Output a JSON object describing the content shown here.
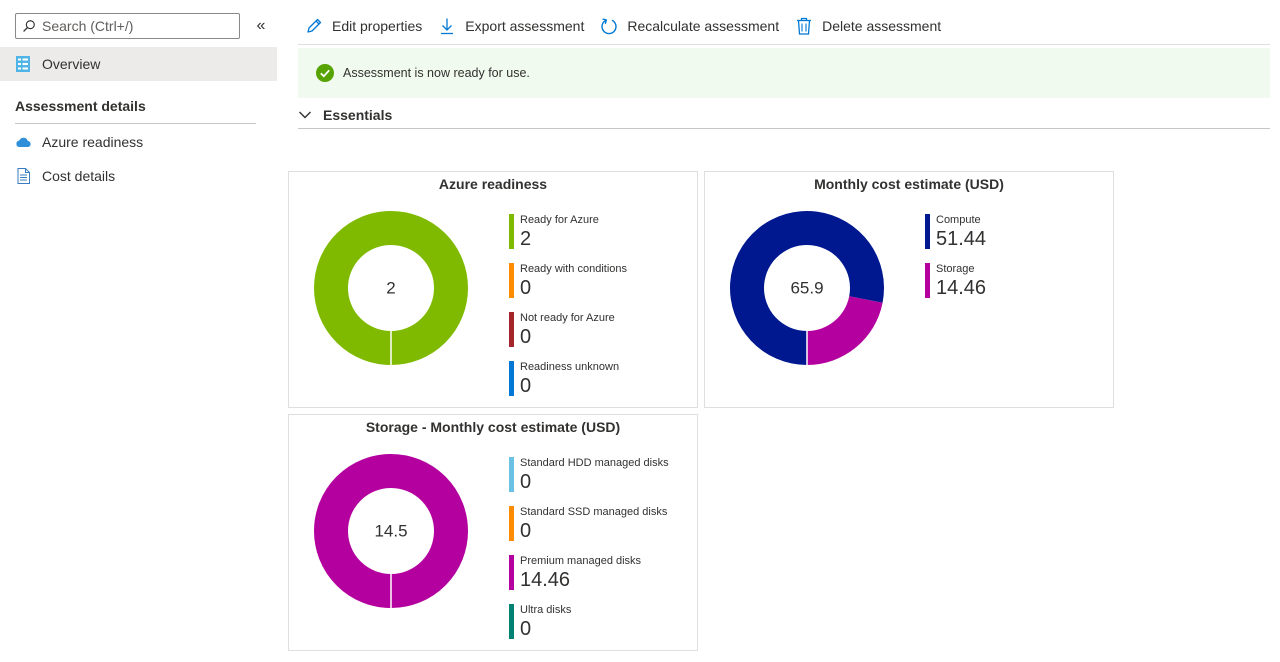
{
  "sidebar": {
    "search_placeholder": "Search (Ctrl+/)",
    "collapse_glyph": "«",
    "overview_label": "Overview",
    "section_title": "Assessment details",
    "items": [
      {
        "label": "Azure readiness",
        "icon": "cloud-icon"
      },
      {
        "label": "Cost details",
        "icon": "document-icon"
      }
    ]
  },
  "toolbar": {
    "edit_label": "Edit properties",
    "export_label": "Export assessment",
    "recalc_label": "Recalculate assessment",
    "delete_label": "Delete assessment"
  },
  "banner": {
    "message": "Assessment is now ready for use."
  },
  "essentials": {
    "label": "Essentials"
  },
  "colors": {
    "accent": "#0078d4",
    "success": "#57a300",
    "banner_bg": "#f1faee"
  },
  "chart_data": [
    {
      "type": "pie",
      "title": "Azure readiness",
      "center_label": "2",
      "segments": [
        {
          "label": "Ready for Azure",
          "value": 2,
          "display": "2",
          "color": "#7fba00"
        },
        {
          "label": "Ready with conditions",
          "value": 0,
          "display": "0",
          "color": "#ff8c00"
        },
        {
          "label": "Not ready for Azure",
          "value": 0,
          "display": "0",
          "color": "#a4262c"
        },
        {
          "label": "Readiness unknown",
          "value": 0,
          "display": "0",
          "color": "#0078d4"
        }
      ]
    },
    {
      "type": "pie",
      "title": "Monthly cost estimate (USD)",
      "center_label": "65.9",
      "segments": [
        {
          "label": "Compute",
          "value": 51.44,
          "display": "51.44",
          "color": "#00188f"
        },
        {
          "label": "Storage",
          "value": 14.46,
          "display": "14.46",
          "color": "#b4009e"
        }
      ]
    },
    {
      "type": "pie",
      "title": "Storage - Monthly cost estimate (USD)",
      "center_label": "14.5",
      "segments": [
        {
          "label": "Standard HDD managed disks",
          "value": 0,
          "display": "0",
          "color": "#6bc1e3"
        },
        {
          "label": "Standard SSD managed disks",
          "value": 0,
          "display": "0",
          "color": "#ff8c00"
        },
        {
          "label": "Premium managed disks",
          "value": 14.46,
          "display": "14.46",
          "color": "#b4009e"
        },
        {
          "label": "Ultra disks",
          "value": 0,
          "display": "0",
          "color": "#008272"
        }
      ]
    }
  ]
}
